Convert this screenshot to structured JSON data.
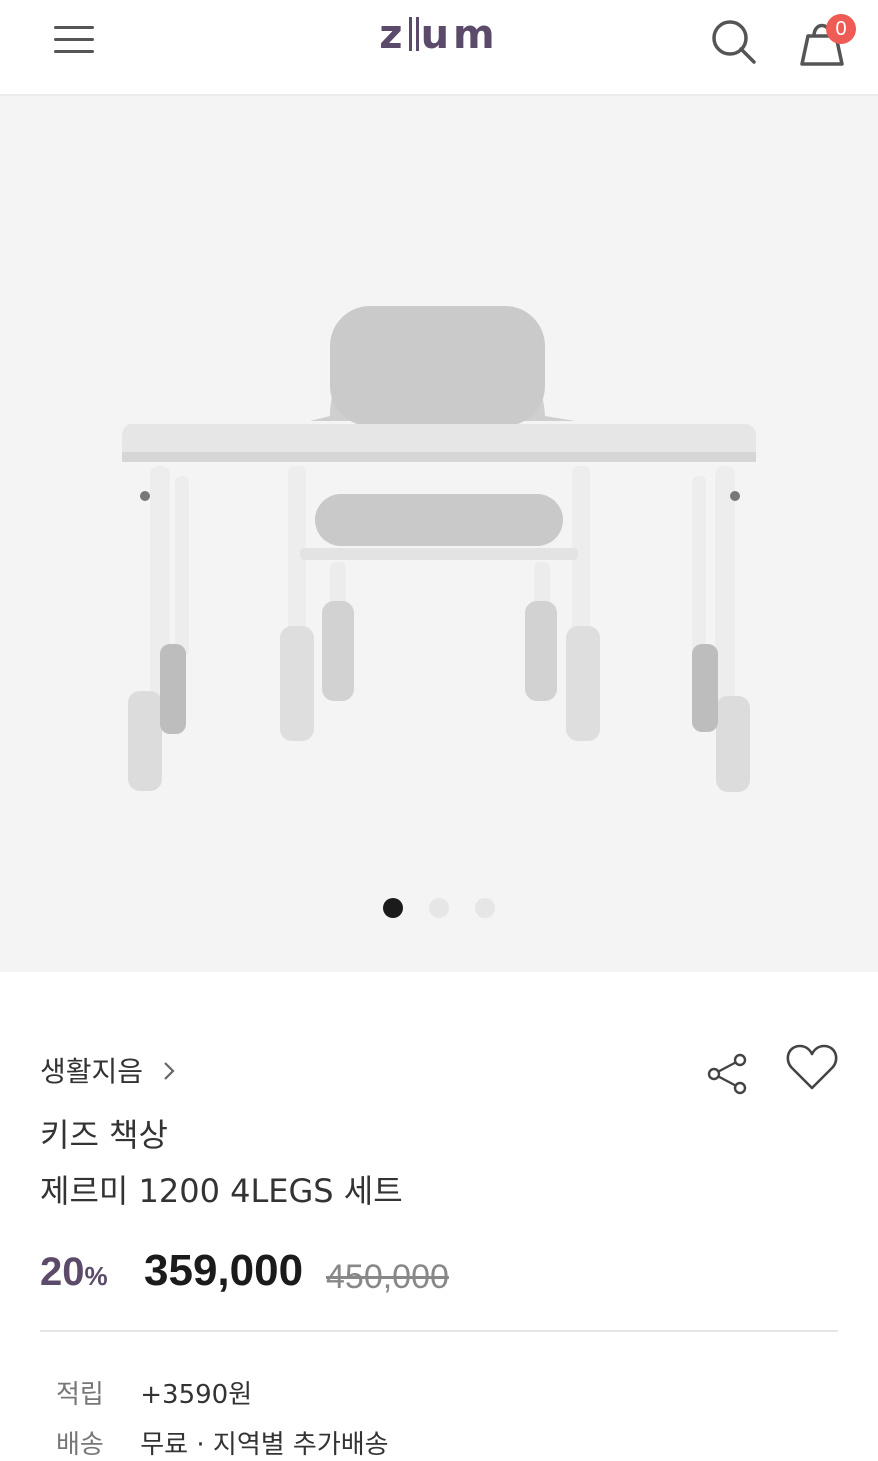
{
  "header": {
    "logo_text": "ziium",
    "cart_count": "0",
    "accent_color": "#5b4a6a",
    "badge_color": "#ee5c55"
  },
  "icons": {
    "menu": "hamburger-menu-icon",
    "search": "search-icon",
    "cart": "shopping-bag-icon",
    "share": "share-icon",
    "like": "heart-icon",
    "brand_link": "chevron-right-icon"
  },
  "gallery": {
    "slide_count": 3,
    "active_slide": 1
  },
  "product": {
    "brand": "생활지음",
    "name_line1": "키즈 책상",
    "name_line2": "제르미 1200 4LEGS 세트",
    "discount_value": "20",
    "discount_unit": "%",
    "price": "359,000",
    "original_price": "450,000"
  },
  "meta": {
    "points_label": "적립",
    "points_value": "+3590원",
    "shipping_label": "배송",
    "shipping_value": "무료 · 지역별 추가배송"
  }
}
